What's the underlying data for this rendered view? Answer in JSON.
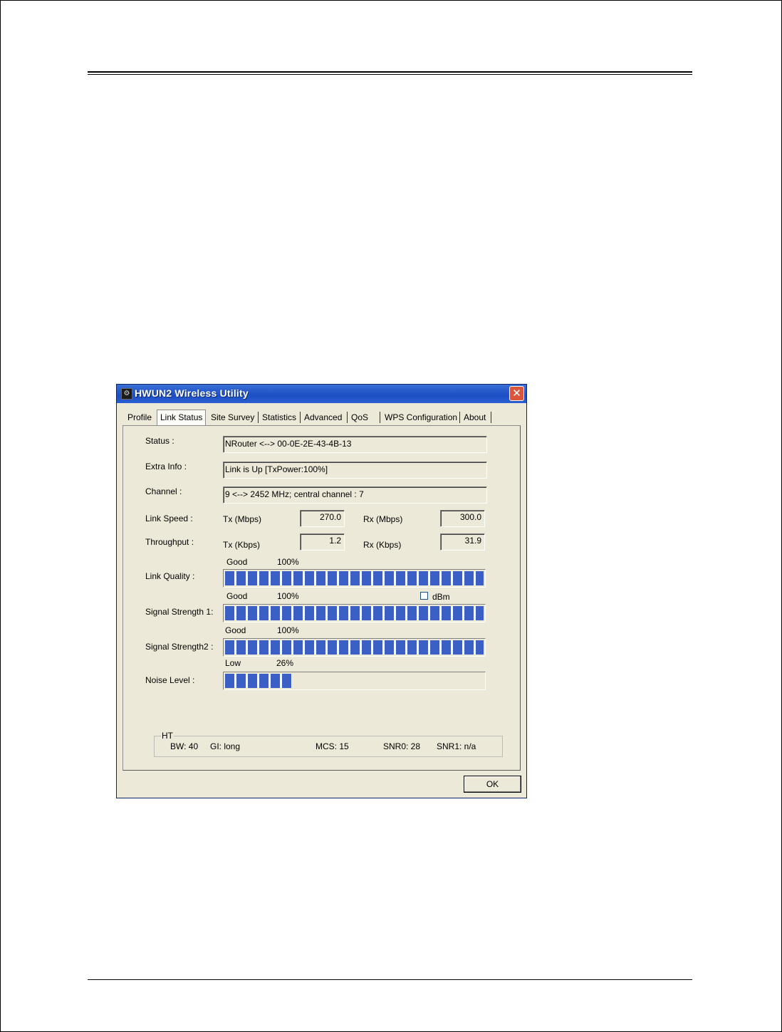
{
  "window": {
    "title": "HWUN2 Wireless Utility",
    "close_glyph": "✕"
  },
  "tabs": [
    {
      "label": "Profile"
    },
    {
      "label": "Link Status",
      "active": true
    },
    {
      "label": "Site Survey"
    },
    {
      "label": "Statistics"
    },
    {
      "label": "Advanced"
    },
    {
      "label": "QoS"
    },
    {
      "label": "WPS Configuration"
    },
    {
      "label": "About"
    }
  ],
  "link_status": {
    "status_label": "Status :",
    "status_value": "NRouter <--> 00-0E-2E-43-4B-13",
    "extra_info_label": "Extra Info :",
    "extra_info_value": "Link is Up [TxPower:100%]",
    "channel_label": "Channel :",
    "channel_value": "9 <--> 2452 MHz; central channel : 7",
    "link_speed_label": "Link Speed :",
    "link_speed_tx_label": "Tx (Mbps)",
    "link_speed_tx": "270.0",
    "link_speed_rx_label": "Rx (Mbps)",
    "link_speed_rx": "300.0",
    "throughput_label": "Throughput :",
    "throughput_tx_label": "Tx (Kbps)",
    "throughput_tx": "1.2",
    "throughput_rx_label": "Rx (Kbps)",
    "throughput_rx": "31.9"
  },
  "meters": {
    "link_quality": {
      "label": "Link Quality :",
      "rating": "Good",
      "percent_text": "100%",
      "value": 100
    },
    "signal_strength_1": {
      "label": "Signal Strength 1:",
      "rating": "Good",
      "percent_text": "100%",
      "value": 100
    },
    "signal_strength_2": {
      "label": "Signal Strength2 :",
      "rating": "Good",
      "percent_text": "100%",
      "value": 100
    },
    "noise_level": {
      "label": "Noise Level :",
      "rating": "Low",
      "percent_text": "26%",
      "value": 26
    },
    "dbm_label": "dBm",
    "dbm_checked": false
  },
  "ht": {
    "legend": "HT",
    "bw": "BW: 40",
    "gi": "GI: long",
    "mcs": "MCS: 15",
    "snr0": "SNR0: 28",
    "snr1": "SNR1: n/a"
  },
  "buttons": {
    "ok": "OK"
  },
  "colors": {
    "bar_fill": "#3b5fc4",
    "titlebar": "#2558c9",
    "window_bg": "#ece9d8",
    "close_button": "#d9563c"
  }
}
